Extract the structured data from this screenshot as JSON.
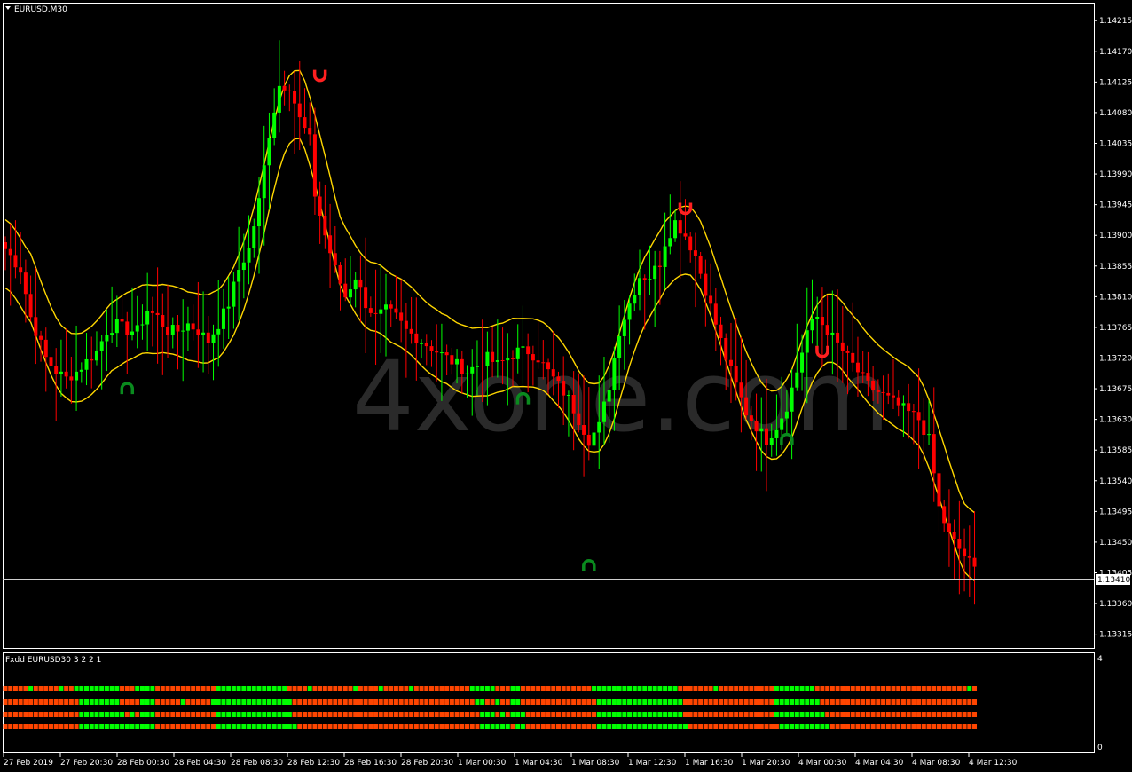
{
  "window": {
    "title": "EURUSD,M30",
    "indicator_label": "Fxdd EURUSD30 3 2 2 1",
    "watermark": "4xone.com",
    "current_price": "1.13410",
    "sub_scale_top": "4",
    "sub_scale_bottom": "0"
  },
  "colors": {
    "background": "#000000",
    "bull": "#00ff00",
    "bear": "#ff0000",
    "band": "#ffd700",
    "signal_sell": "#ff2020",
    "signal_buy": "#0a8a1e",
    "strip_orange": "#ff4500",
    "strip_green": "#00ff00",
    "grid": "#ffffff"
  },
  "icons": {
    "sell_signal": "horseshoe-down-icon",
    "buy_signal": "horseshoe-up-icon"
  },
  "chart_data": {
    "type": "candlestick",
    "symbol": "EURUSD",
    "timeframe": "M30",
    "y_range": [
      1.13295,
      1.1424
    ],
    "price_ticks": [
      "1.14215",
      "1.14170",
      "1.14125",
      "1.14080",
      "1.14035",
      "1.13990",
      "1.13945",
      "1.13900",
      "1.13855",
      "1.13810",
      "1.13765",
      "1.13720",
      "1.13675",
      "1.13630",
      "1.13585",
      "1.13540",
      "1.13495",
      "1.13450",
      "1.13405",
      "1.13360",
      "1.13315"
    ],
    "time_labels": [
      "27 Feb 2019",
      "27 Feb 20:30",
      "28 Feb 00:30",
      "28 Feb 04:30",
      "28 Feb 08:30",
      "28 Feb 12:30",
      "28 Feb 16:30",
      "28 Feb 20:30",
      "1 Mar 00:30",
      "1 Mar 04:30",
      "1 Mar 08:30",
      "1 Mar 12:30",
      "1 Mar 16:30",
      "1 Mar 20:30",
      "4 Mar 00:30",
      "4 Mar 04:30",
      "4 Mar 08:30",
      "4 Mar 12:30"
    ],
    "anchors": [
      [
        0,
        1.1388
      ],
      [
        3,
        1.1385
      ],
      [
        5,
        1.1378
      ],
      [
        8,
        1.1372
      ],
      [
        10,
        1.137
      ],
      [
        12,
        1.1369
      ],
      [
        14,
        1.137
      ],
      [
        16,
        1.13715
      ],
      [
        18,
        1.1373
      ],
      [
        20,
        1.1376
      ],
      [
        22,
        1.1377
      ],
      [
        24,
        1.1376
      ],
      [
        26,
        1.1376
      ],
      [
        28,
        1.1379
      ],
      [
        30,
        1.1378
      ],
      [
        32,
        1.1376
      ],
      [
        34,
        1.1376
      ],
      [
        36,
        1.1377
      ],
      [
        38,
        1.1376
      ],
      [
        40,
        1.13745
      ],
      [
        42,
        1.1377
      ],
      [
        44,
        1.138
      ],
      [
        46,
        1.1385
      ],
      [
        48,
        1.1388
      ],
      [
        50,
        1.1395
      ],
      [
        52,
        1.1405
      ],
      [
        54,
        1.1412
      ],
      [
        56,
        1.1412
      ],
      [
        58,
        1.1407
      ],
      [
        60,
        1.1404
      ],
      [
        61,
        1.1396
      ],
      [
        63,
        1.139
      ],
      [
        65,
        1.1385
      ],
      [
        67,
        1.1381
      ],
      [
        69,
        1.1384
      ],
      [
        71,
        1.138
      ],
      [
        73,
        1.1378
      ],
      [
        75,
        1.1379
      ],
      [
        77,
        1.1378
      ],
      [
        79,
        1.1376
      ],
      [
        81,
        1.1375
      ],
      [
        83,
        1.1374
      ],
      [
        85,
        1.1373
      ],
      [
        87,
        1.1372
      ],
      [
        89,
        1.1371
      ],
      [
        91,
        1.137
      ],
      [
        93,
        1.1371
      ],
      [
        95,
        1.1372
      ],
      [
        97,
        1.1371
      ],
      [
        99,
        1.1372
      ],
      [
        101,
        1.1373
      ],
      [
        103,
        1.1373
      ],
      [
        105,
        1.1372
      ],
      [
        107,
        1.137
      ],
      [
        109,
        1.1368
      ],
      [
        111,
        1.1366
      ],
      [
        113,
        1.1363
      ],
      [
        115,
        1.136
      ],
      [
        117,
        1.1362
      ],
      [
        119,
        1.1368
      ],
      [
        121,
        1.1376
      ],
      [
        123,
        1.138
      ],
      [
        125,
        1.1384
      ],
      [
        127,
        1.1384
      ],
      [
        129,
        1.1386
      ],
      [
        130,
        1.1389
      ],
      [
        132,
        1.1392
      ],
      [
        134,
        1.139
      ],
      [
        136,
        1.1387
      ],
      [
        138,
        1.1382
      ],
      [
        140,
        1.1377
      ],
      [
        142,
        1.1372
      ],
      [
        144,
        1.1368
      ],
      [
        146,
        1.1364
      ],
      [
        148,
        1.1362
      ],
      [
        150,
        1.136
      ],
      [
        152,
        1.1362
      ],
      [
        154,
        1.1365
      ],
      [
        156,
        1.137
      ],
      [
        158,
        1.1376
      ],
      [
        160,
        1.1378
      ],
      [
        162,
        1.1376
      ],
      [
        164,
        1.1374
      ],
      [
        166,
        1.1372
      ],
      [
        168,
        1.137
      ],
      [
        170,
        1.1368
      ],
      [
        172,
        1.1367
      ],
      [
        174,
        1.1366
      ],
      [
        176,
        1.1365
      ],
      [
        178,
        1.1364
      ],
      [
        180,
        1.1363
      ],
      [
        182,
        1.136
      ],
      [
        184,
        1.135
      ],
      [
        186,
        1.1346
      ],
      [
        188,
        1.1344
      ],
      [
        190,
        1.1342
      ],
      [
        191,
        1.1341
      ]
    ],
    "signals": [
      {
        "type": "sell",
        "bar": 62,
        "price": 1.14135
      },
      {
        "type": "sell",
        "bar": 134,
        "price": 1.1394
      },
      {
        "type": "sell",
        "bar": 161,
        "price": 1.1373
      },
      {
        "type": "buy",
        "bar": 24,
        "price": 1.13675
      },
      {
        "type": "buy",
        "bar": 102,
        "price": 1.1366
      },
      {
        "type": "buy",
        "bar": 115,
        "price": 1.13415
      },
      {
        "type": "buy",
        "bar": 154,
        "price": 1.136
      }
    ]
  }
}
